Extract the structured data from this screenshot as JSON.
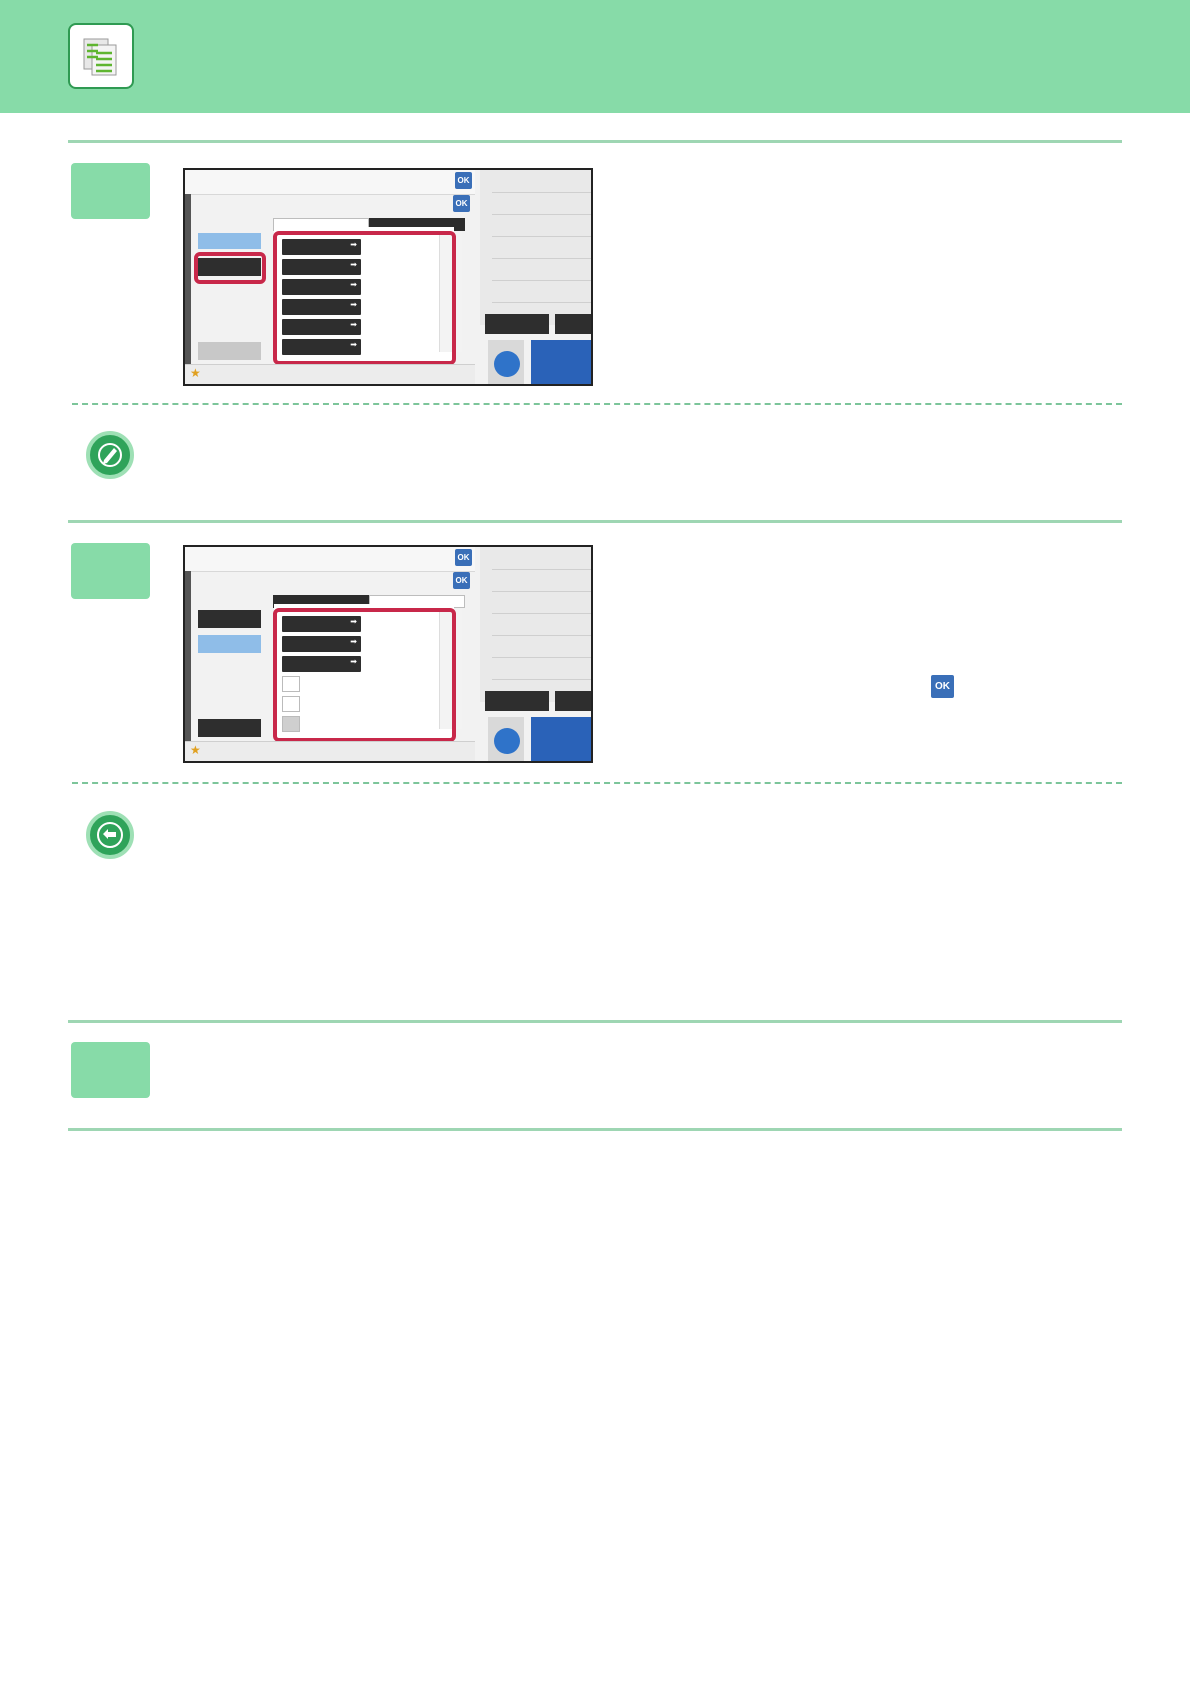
{
  "header": {
    "logo_icon": "copy-document-icon"
  },
  "steps": [
    {
      "screenshot": {
        "ok_buttons": [
          "OK",
          "OK"
        ],
        "list_items": 6,
        "highlighted": "menu-list-and-side-button"
      },
      "note_icon": "pencil-note-icon"
    },
    {
      "screenshot": {
        "ok_buttons": [
          "OK",
          "OK"
        ],
        "list_items": 3,
        "highlighted": "menu-list"
      },
      "inline_ok_label": "OK",
      "note_icon": "return-arrow-icon"
    },
    {}
  ],
  "colors": {
    "header_bg": "#87dba8",
    "step_box": "#87dba8",
    "accent_green": "#2fa35a",
    "highlight_red": "#c8284a",
    "ok_blue": "#3a6fb8"
  }
}
